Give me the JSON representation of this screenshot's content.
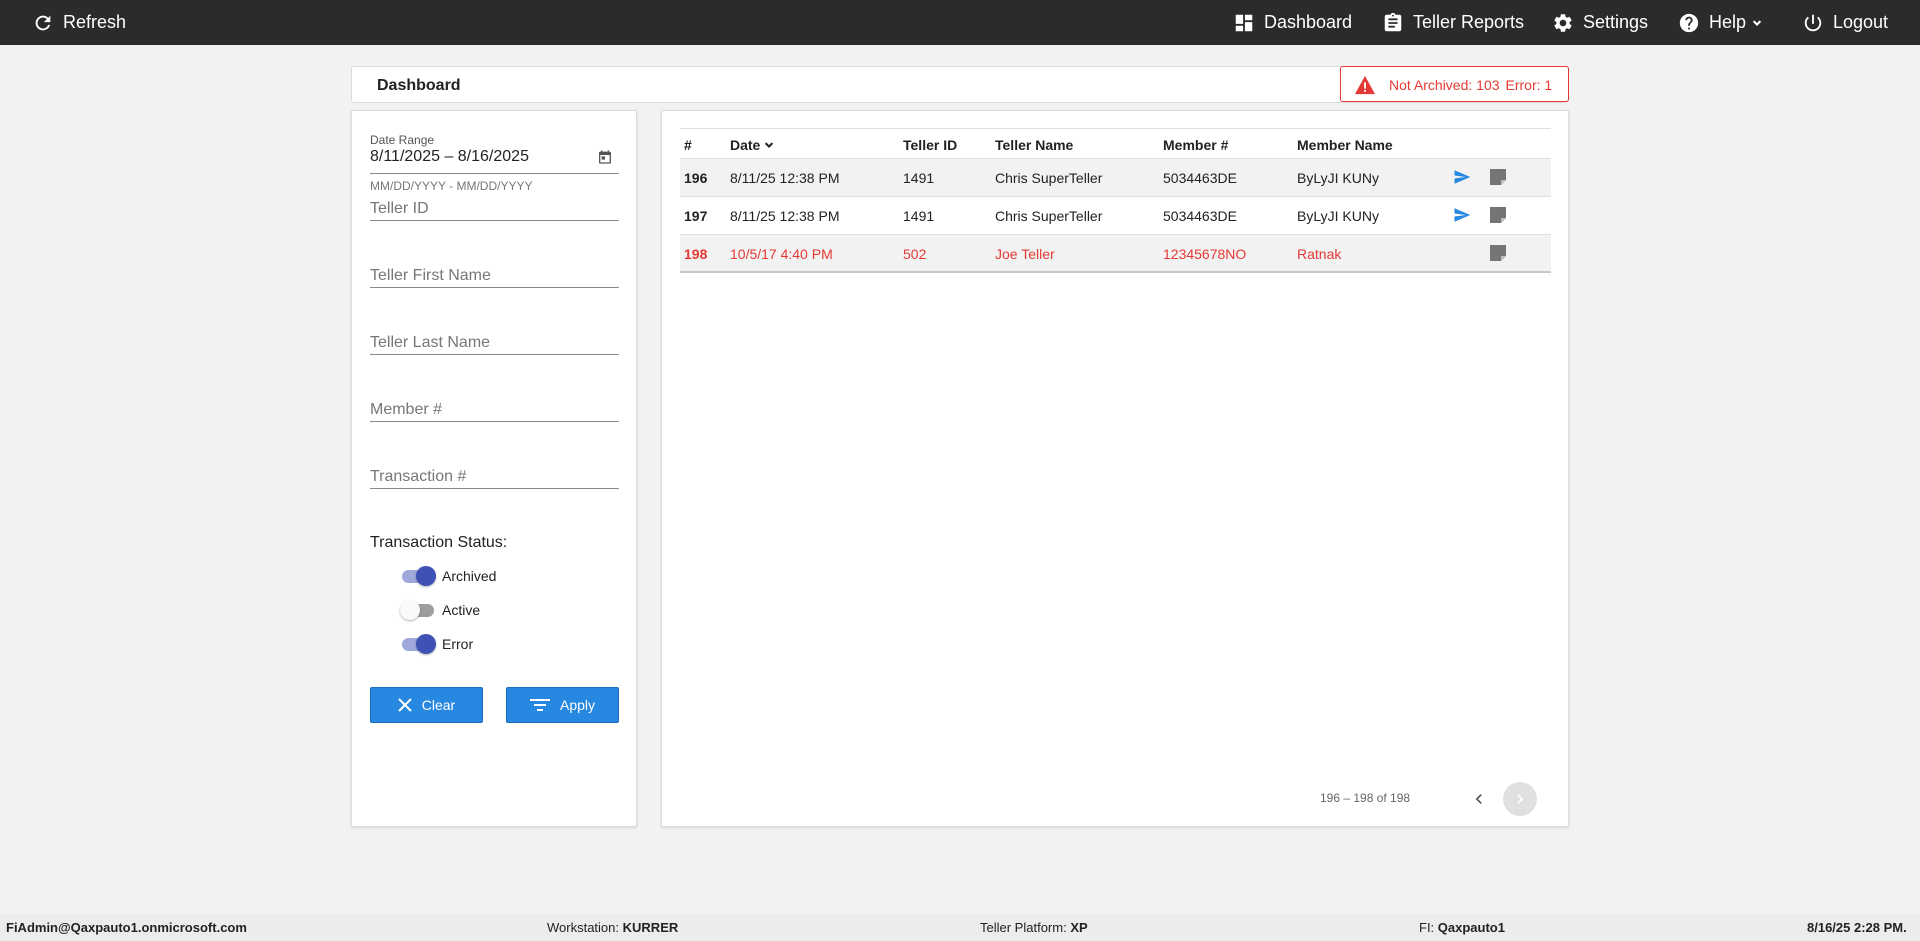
{
  "topbar": {
    "refresh": "Refresh",
    "dashboard": "Dashboard",
    "teller_reports": "Teller Reports",
    "settings": "Settings",
    "help": "Help",
    "logout": "Logout"
  },
  "header": {
    "title": "Dashboard",
    "alert": {
      "not_archived": "Not Archived: 103",
      "error": "Error: 1",
      "color": "#e53935"
    }
  },
  "filters": {
    "date_range_label": "Date Range",
    "date_range_value": "8/11/2025 – 8/16/2025",
    "date_range_hint": "MM/DD/YYYY - MM/DD/YYYY",
    "teller_id_placeholder": "Teller ID",
    "teller_first_name_placeholder": "Teller First Name",
    "teller_last_name_placeholder": "Teller Last Name",
    "member_placeholder": "Member #",
    "transaction_placeholder": "Transaction #",
    "status_label": "Transaction Status:",
    "statuses": [
      {
        "label": "Archived",
        "on": true
      },
      {
        "label": "Active",
        "on": false
      },
      {
        "label": "Error",
        "on": true
      }
    ],
    "clear_label": "Clear",
    "apply_label": "Apply"
  },
  "table": {
    "columns": [
      "#",
      "Date",
      "Teller ID",
      "Teller Name",
      "Member #",
      "Member Name"
    ],
    "rows": [
      {
        "num": "196",
        "date": "8/11/25 12:38 PM",
        "teller_id": "1491",
        "teller_name": "Chris SuperTeller",
        "member_num": "5034463DE",
        "member_name": "ByLyJI KUNy",
        "sent_icon": true,
        "error": false
      },
      {
        "num": "197",
        "date": "8/11/25 12:38 PM",
        "teller_id": "1491",
        "teller_name": "Chris SuperTeller",
        "member_num": "5034463DE",
        "member_name": "ByLyJI KUNy",
        "sent_icon": true,
        "error": false
      },
      {
        "num": "198",
        "date": "10/5/17 4:40 PM",
        "teller_id": "502",
        "teller_name": "Joe Teller",
        "member_num": "12345678NO",
        "member_name": "Ratnak",
        "sent_icon": false,
        "error": true
      }
    ],
    "pager": "196 – 198 of 198"
  },
  "footer": {
    "user": "FiAdmin@Qaxpauto1.onmicrosoft.com",
    "workstation_label": "Workstation:",
    "workstation": "KURRER",
    "platform_label": "Teller Platform:",
    "platform": "XP",
    "fi_label": "FI:",
    "fi": "Qaxpauto1",
    "datetime": "8/16/25 2:28 PM."
  },
  "colors": {
    "accent": "#2688e0",
    "toggle": "#3f51b5",
    "error": "#e53935",
    "topbar": "#2b2b2b"
  }
}
